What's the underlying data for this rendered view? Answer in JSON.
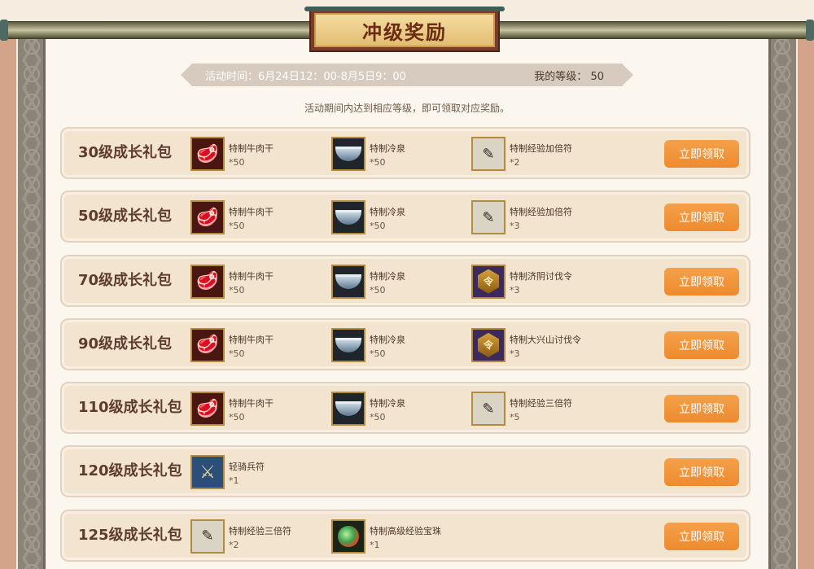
{
  "title": "冲级奖励",
  "info": {
    "time": "活动时间：6月24日12：00-8月5日9：00",
    "level_label": "我的等级：",
    "level_value": "50"
  },
  "description": "活动期间内达到相应等级，即可领取对应奖励。",
  "claim_label": "立即领取",
  "rows": [
    {
      "name": "30级成长礼包",
      "items": [
        {
          "name": "特制牛肉干",
          "count": "*50",
          "icon": "beef-icon"
        },
        {
          "name": "特制冷泉",
          "count": "*50",
          "icon": "spring-water-icon"
        },
        {
          "name": "特制经验加倍符",
          "count": "*2",
          "icon": "exp-scroll-icon"
        }
      ]
    },
    {
      "name": "50级成长礼包",
      "items": [
        {
          "name": "特制牛肉干",
          "count": "*50",
          "icon": "beef-icon"
        },
        {
          "name": "特制冷泉",
          "count": "*50",
          "icon": "spring-water-icon"
        },
        {
          "name": "特制经验加倍符",
          "count": "*3",
          "icon": "exp-scroll-icon"
        }
      ]
    },
    {
      "name": "70级成长礼包",
      "items": [
        {
          "name": "特制牛肉干",
          "count": "*50",
          "icon": "beef-icon"
        },
        {
          "name": "特制冷泉",
          "count": "*50",
          "icon": "spring-water-icon"
        },
        {
          "name": "特制济阴讨伐令",
          "count": "*3",
          "icon": "order-token-icon"
        }
      ]
    },
    {
      "name": "90级成长礼包",
      "items": [
        {
          "name": "特制牛肉干",
          "count": "*50",
          "icon": "beef-icon"
        },
        {
          "name": "特制冷泉",
          "count": "*50",
          "icon": "spring-water-icon"
        },
        {
          "name": "特制大兴山讨伐令",
          "count": "*3",
          "icon": "order-token-icon"
        }
      ]
    },
    {
      "name": "110级成长礼包",
      "items": [
        {
          "name": "特制牛肉干",
          "count": "*50",
          "icon": "beef-icon"
        },
        {
          "name": "特制冷泉",
          "count": "*50",
          "icon": "spring-water-icon"
        },
        {
          "name": "特制经验三倍符",
          "count": "*5",
          "icon": "exp-scroll-icon"
        }
      ]
    },
    {
      "name": "120级成长礼包",
      "items": [
        {
          "name": "轻骑兵符",
          "count": "*1",
          "icon": "cavalry-icon"
        }
      ]
    },
    {
      "name": "125级成长礼包",
      "items": [
        {
          "name": "特制经验三倍符",
          "count": "*2",
          "icon": "exp-scroll-icon"
        },
        {
          "name": "特制高级经验宝珠",
          "count": "*1",
          "icon": "exp-pearl-icon"
        }
      ]
    }
  ]
}
